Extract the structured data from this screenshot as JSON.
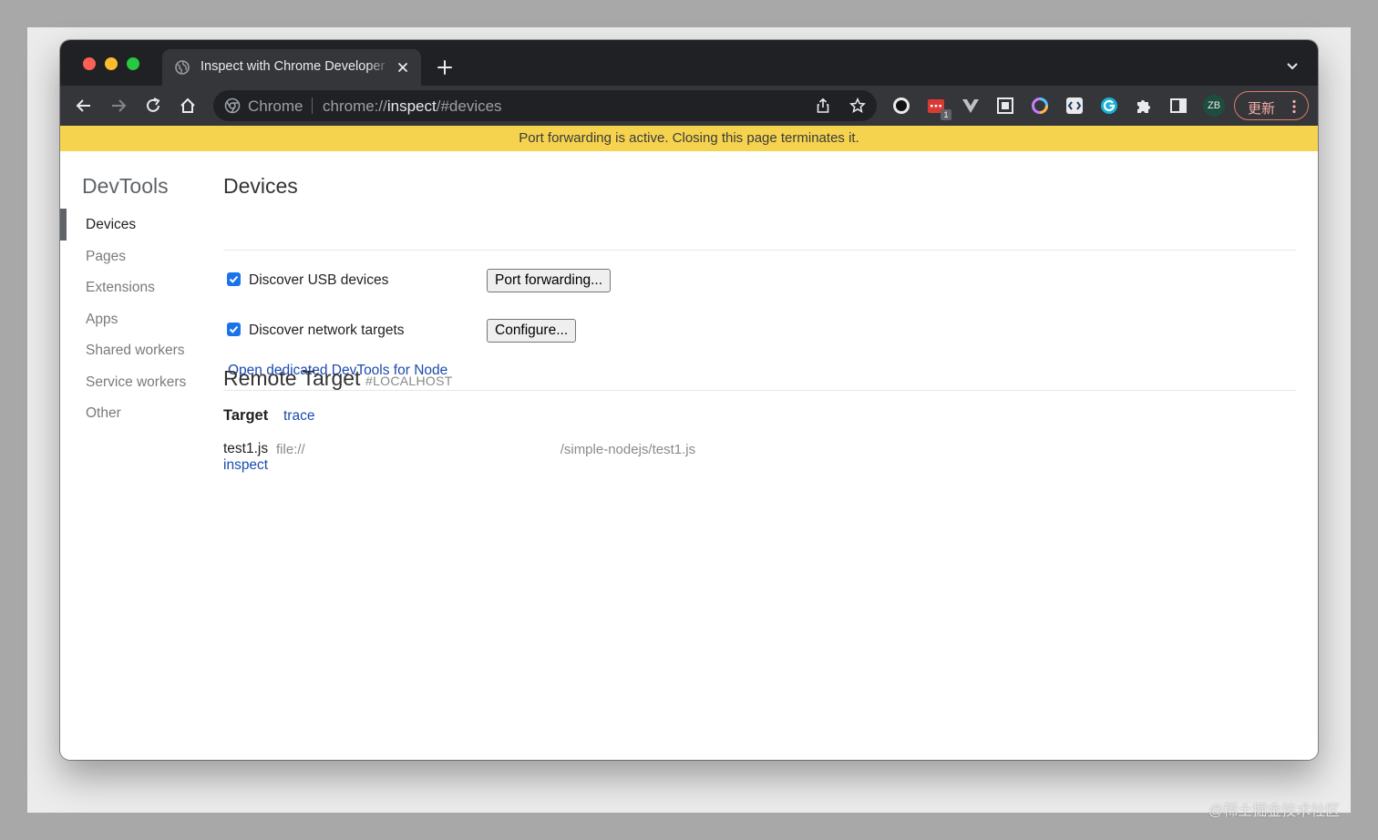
{
  "browser": {
    "tab_title": "Inspect with Chrome Developer Tools",
    "omnibox_label": "Chrome",
    "url_scheme": "chrome://",
    "url_host": "inspect",
    "url_path": "/#devices",
    "extension_badge": "1",
    "avatar_initials": "ZB",
    "update_label": "更新"
  },
  "infobar": {
    "message": "Port forwarding is active. Closing this page terminates it."
  },
  "sidebar": {
    "title": "DevTools",
    "items": [
      {
        "label": "Devices",
        "active": true
      },
      {
        "label": "Pages",
        "active": false
      },
      {
        "label": "Extensions",
        "active": false
      },
      {
        "label": "Apps",
        "active": false
      },
      {
        "label": "Shared workers",
        "active": false
      },
      {
        "label": "Service workers",
        "active": false
      },
      {
        "label": "Other",
        "active": false
      }
    ]
  },
  "devices": {
    "title": "Devices",
    "discover_usb_label": "Discover USB devices",
    "discover_usb_checked": true,
    "port_forwarding_button": "Port forwarding...",
    "discover_network_label": "Discover network targets",
    "discover_network_checked": true,
    "configure_button": "Configure...",
    "node_link": "Open dedicated DevTools for Node"
  },
  "remote_target": {
    "title": "Remote Target",
    "subtitle": "#LOCALHOST",
    "target_label": "Target",
    "trace_link": "trace",
    "entry_name": "test1.js",
    "entry_url_start": "file://",
    "entry_url_end": "/simple-nodejs/test1.js",
    "inspect_link": "inspect"
  },
  "watermark": "@稀土掘金技术社区",
  "colors": {
    "infobar_bg": "#f5d34f",
    "link": "#1a4bb0",
    "checkbox": "#1a73e8",
    "chrome_dark": "#202124",
    "toolbar": "#35363a"
  }
}
